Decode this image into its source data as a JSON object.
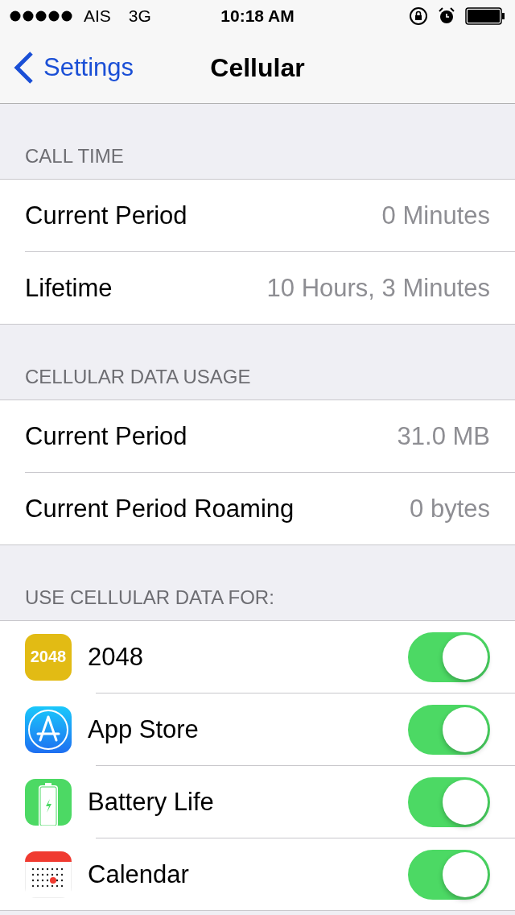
{
  "status_bar": {
    "carrier": "AIS",
    "network": "3G",
    "time": "10:18 AM"
  },
  "nav": {
    "back": "Settings",
    "title": "Cellular"
  },
  "sections": [
    {
      "header": "CALL TIME",
      "rows": [
        {
          "label": "Current Period",
          "value": "0 Minutes"
        },
        {
          "label": "Lifetime",
          "value": "10 Hours, 3 Minutes"
        }
      ]
    },
    {
      "header": "CELLULAR DATA USAGE",
      "rows": [
        {
          "label": "Current Period",
          "value": "31.0 MB"
        },
        {
          "label": "Current Period Roaming",
          "value": "0 bytes"
        }
      ]
    }
  ],
  "apps_section": {
    "header": "USE CELLULAR DATA FOR:",
    "apps": [
      {
        "name": "2048",
        "kind": "tile",
        "icon_text": "2048",
        "on": true
      },
      {
        "name": "App Store",
        "kind": "store",
        "on": true
      },
      {
        "name": "Battery Life",
        "kind": "battery",
        "on": true
      },
      {
        "name": "Calendar",
        "kind": "calendar",
        "on": true
      }
    ]
  }
}
